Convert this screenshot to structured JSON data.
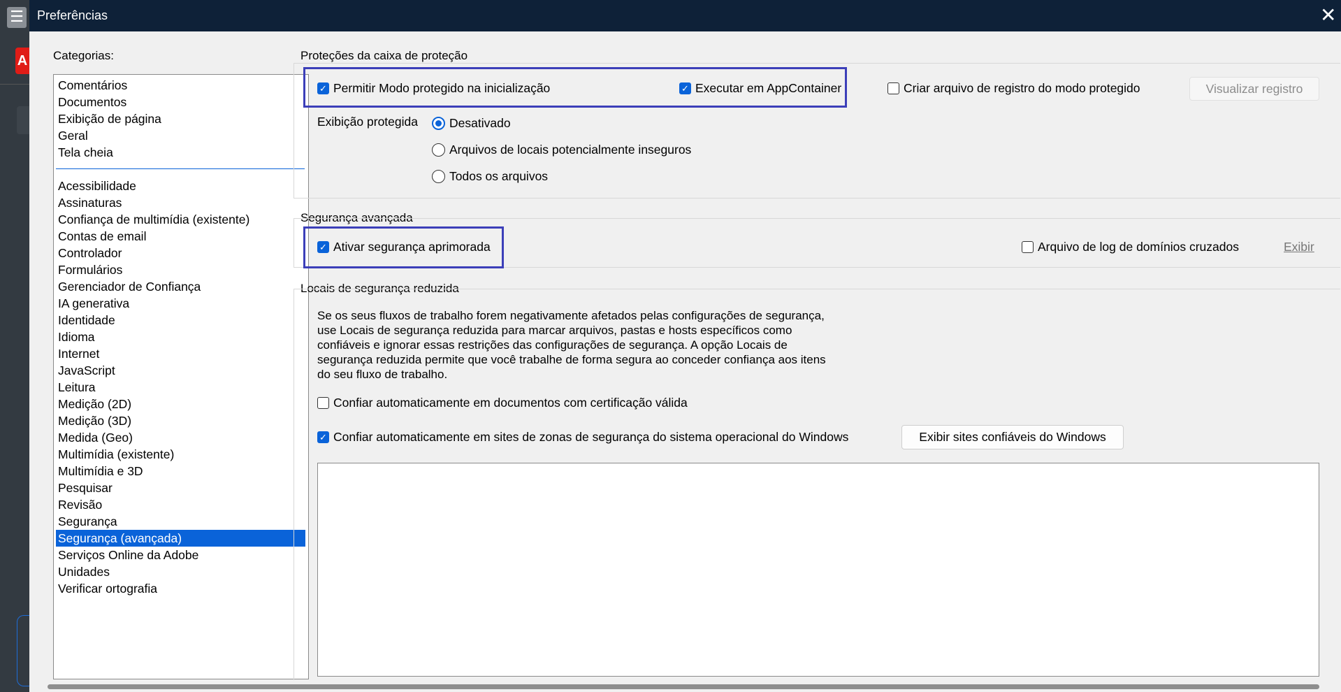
{
  "background": {
    "menu_icon": "☰",
    "logo_icon": "A"
  },
  "window": {
    "title": "Preferências",
    "close_icon": "✕"
  },
  "categories": {
    "label": "Categorias:",
    "top_items": [
      "Comentários",
      "Documentos",
      "Exibição de página",
      "Geral",
      "Tela cheia"
    ],
    "items": [
      "Acessibilidade",
      "Assinaturas",
      "Confiança de multimídia (existente)",
      "Contas de email",
      "Controlador",
      "Formulários",
      "Gerenciador de Confiança",
      "IA generativa",
      "Identidade",
      "Idioma",
      "Internet",
      "JavaScript",
      "Leitura",
      "Medição (2D)",
      "Medição (3D)",
      "Medida (Geo)",
      "Multimídia (existente)",
      "Multimídia e 3D",
      "Pesquisar",
      "Revisão",
      "Segurança",
      "Segurança (avançada)",
      "Serviços Online da Adobe",
      "Unidades",
      "Verificar ortografia"
    ],
    "selected": "Segurança (avançada)"
  },
  "sandbox": {
    "title": "Proteções da caixa de proteção",
    "protected_mode": {
      "label": "Permitir Modo protegido na inicialização",
      "checked": true
    },
    "appcontainer": {
      "label": "Executar em AppContainer",
      "checked": true
    },
    "log_file": {
      "label": "Criar arquivo de registro do modo protegido",
      "checked": false
    },
    "view_log_button": "Visualizar registro",
    "protected_view_label": "Exibição protegida",
    "protected_view_options": [
      "Desativado",
      "Arquivos de locais potencialmente inseguros",
      "Todos os arquivos"
    ],
    "protected_view_selected": "Desativado"
  },
  "enhanced": {
    "title": "Segurança avançada",
    "enable": {
      "label": "Ativar segurança aprimorada",
      "checked": true
    },
    "crossdomain_log": {
      "label": "Arquivo de log de domínios cruzados",
      "checked": false
    },
    "view_link": "Exibir"
  },
  "privileged": {
    "title": "Locais de segurança reduzida",
    "description": "Se os seus fluxos de trabalho forem negativamente afetados pelas configurações de segurança, use Locais de segurança reduzida para marcar arquivos, pastas e hosts específicos como confiáveis e ignorar essas restrições das configurações de segurança. A opção Locais de segurança reduzida permite que você trabalhe de forma segura ao conceder confiança aos itens do seu fluxo de trabalho.",
    "trust_certified": {
      "label": "Confiar automaticamente em documentos com certificação válida",
      "checked": false
    },
    "trust_os_zones": {
      "label": "Confiar automaticamente em sites de zonas de segurança do sistema operacional do Windows",
      "checked": true
    },
    "view_windows_sites_button": "Exibir sites confiáveis do Windows"
  },
  "colors": {
    "titlebar": "#0e2138",
    "accent": "#0a63d9",
    "highlight": "#3c3fb9"
  }
}
